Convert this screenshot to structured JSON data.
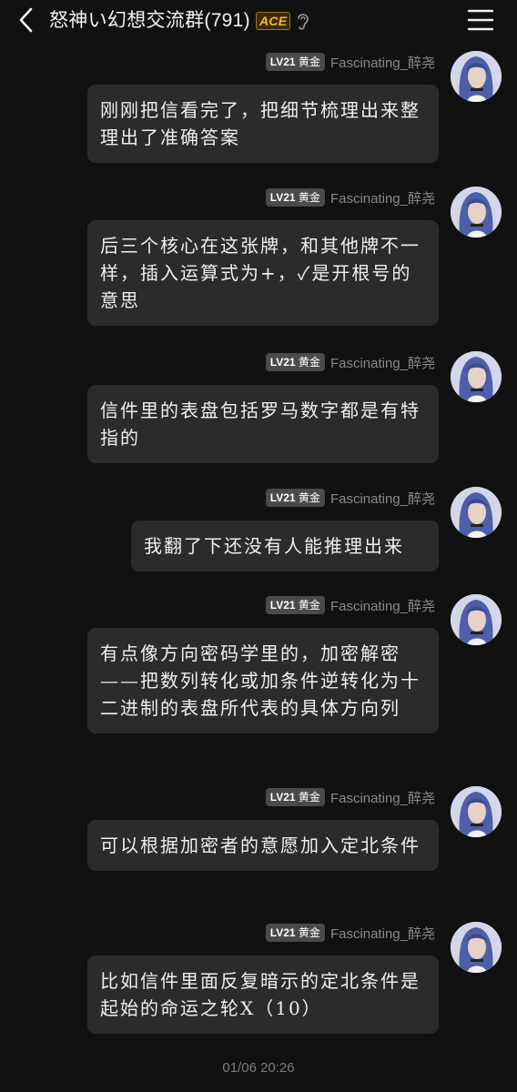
{
  "header": {
    "title": "怒神い幻想交流群",
    "member_count": "(791)",
    "badge": "ACE",
    "icons": [
      "back-arrow-icon",
      "ear-icon",
      "menu-icon"
    ]
  },
  "messages": [
    {
      "level": "LV21",
      "rank": "黄金",
      "sender": "Fascinating_醉尧",
      "text": "刚刚把信看完了，把细节梳理出来整理出了准确答案"
    },
    {
      "level": "LV21",
      "rank": "黄金",
      "sender": "Fascinating_醉尧",
      "text": "后三个核心在这张牌，和其他牌不一样，插入运算式为+，✓是开根号的意思"
    },
    {
      "level": "LV21",
      "rank": "黄金",
      "sender": "Fascinating_醉尧",
      "text": "信件里的表盘包括罗马数字都是有特指的"
    },
    {
      "level": "LV21",
      "rank": "黄金",
      "sender": "Fascinating_醉尧",
      "text": "我翻了下还没有人能推理出来"
    },
    {
      "level": "LV21",
      "rank": "黄金",
      "sender": "Fascinating_醉尧",
      "text": "有点像方向密码学里的，加密解密——把数列转化或加条件逆转化为十二进制的表盘所代表的具体方向列"
    },
    {
      "level": "LV21",
      "rank": "黄金",
      "sender": "Fascinating_醉尧",
      "text": "可以根据加密者的意愿加入定北条件"
    },
    {
      "level": "LV21",
      "rank": "黄金",
      "sender": "Fascinating_醉尧",
      "text": "比如信件里面反复暗示的定北条件是起始的命运之轮X（10）"
    }
  ],
  "timestamp": "01/06 20:26"
}
